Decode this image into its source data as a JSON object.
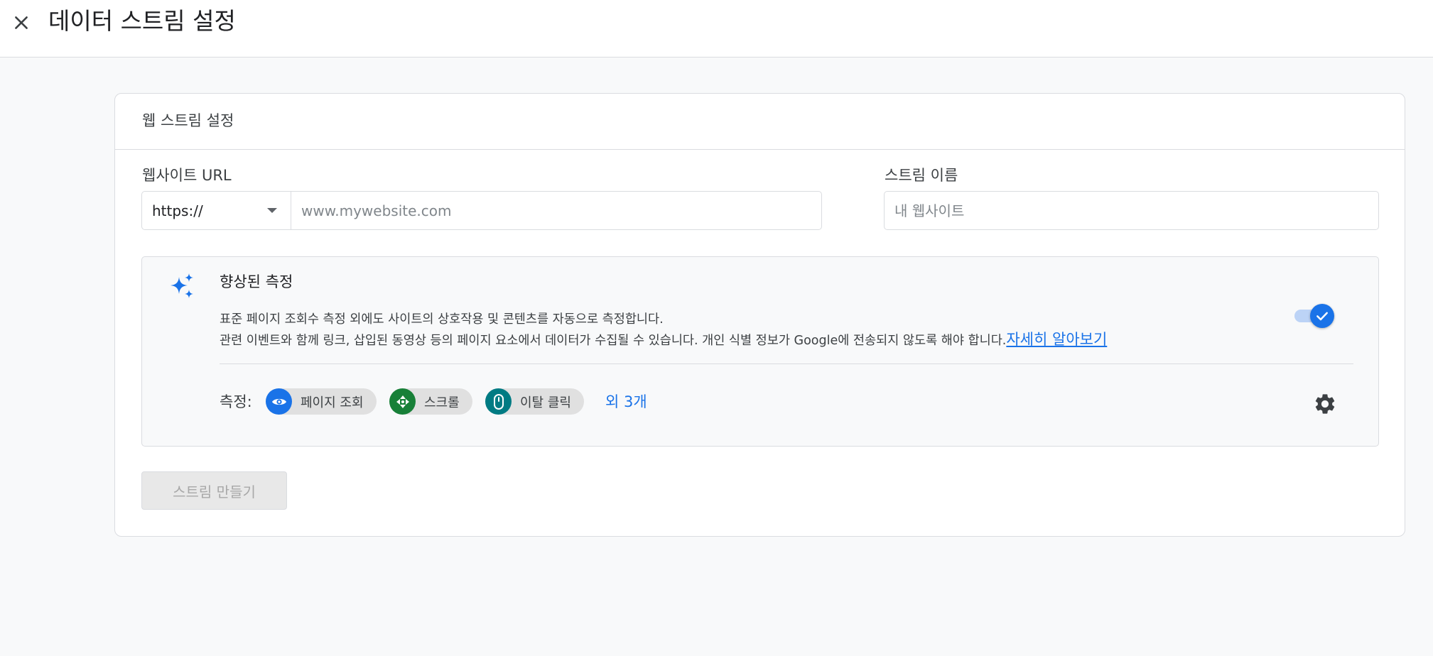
{
  "header": {
    "title": "데이터 스트림 설정",
    "close_icon": "close-icon"
  },
  "card": {
    "title": "웹 스트림 설정"
  },
  "url_field": {
    "label": "웹사이트 URL",
    "protocol": "https://",
    "placeholder": "www.mywebsite.com"
  },
  "name_field": {
    "label": "스트림 이름",
    "placeholder": "내 웹사이트"
  },
  "enhanced_measurement": {
    "title": "향상된 측정",
    "description_line1": "표준 페이지 조회수 측정 외에도 사이트의 상호작용 및 콘텐츠를 자동으로 측정합니다.",
    "description_line2": "관련 이벤트와 함께 링크, 삽입된 동영상 등의 페이지 요소에서 데이터가 수집될 수 있습니다. 개인 식별 정보가 Google에 전송되지 않도록 해야 합니다.",
    "learn_more": "자세히 알아보기",
    "enabled": true,
    "measure_label": "측정:",
    "chips": [
      {
        "label": "페이지 조회",
        "icon": "eye-icon",
        "color": "#1a73e8"
      },
      {
        "label": "스크롤",
        "icon": "scroll-icon",
        "color": "#188038"
      },
      {
        "label": "이탈 클릭",
        "icon": "mouse-icon",
        "color": "#007b83"
      }
    ],
    "more": "외 3개"
  },
  "actions": {
    "create_label": "스트림 만들기"
  },
  "colors": {
    "accent": "#1a73e8",
    "border": "#dadce0",
    "background": "#f8f9fa"
  }
}
